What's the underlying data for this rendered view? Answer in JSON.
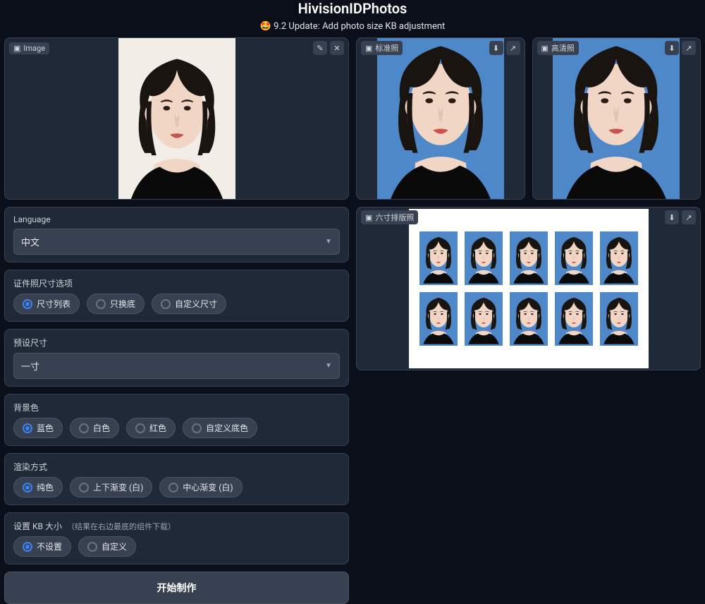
{
  "header": {
    "title": "HivisionIDPhotos",
    "update_emoji": "🤩",
    "update_text": "9.2 Update: Add photo size KB adjustment"
  },
  "panels": {
    "input": {
      "label": "Image",
      "edit_icon": "edit-icon",
      "close_icon": "close-icon"
    },
    "standard": {
      "label": "标准照"
    },
    "hd": {
      "label": "高清照"
    },
    "layout": {
      "label": "六寸排版照"
    }
  },
  "form": {
    "language": {
      "label": "Language",
      "value": "中文"
    },
    "size_option": {
      "label": "证件照尺寸选项",
      "options": [
        "尺寸列表",
        "只换底",
        "自定义尺寸"
      ],
      "selected": 0
    },
    "preset": {
      "label": "预设尺寸",
      "value": "一寸"
    },
    "bg_color": {
      "label": "背景色",
      "options": [
        "蓝色",
        "白色",
        "红色",
        "自定义底色"
      ],
      "selected": 0
    },
    "render_mode": {
      "label": "渲染方式",
      "options": [
        "纯色",
        "上下渐变 (白)",
        "中心渐变 (白)"
      ],
      "selected": 0
    },
    "kb": {
      "label": "设置 KB 大小",
      "helper": "（结果在右边最底的组件下载）",
      "options": [
        "不设置",
        "自定义"
      ],
      "selected": 0
    }
  },
  "start_button": "开始制作",
  "colors": {
    "input_bg": "#f2ede7",
    "id_bg": "#4f88c9"
  }
}
